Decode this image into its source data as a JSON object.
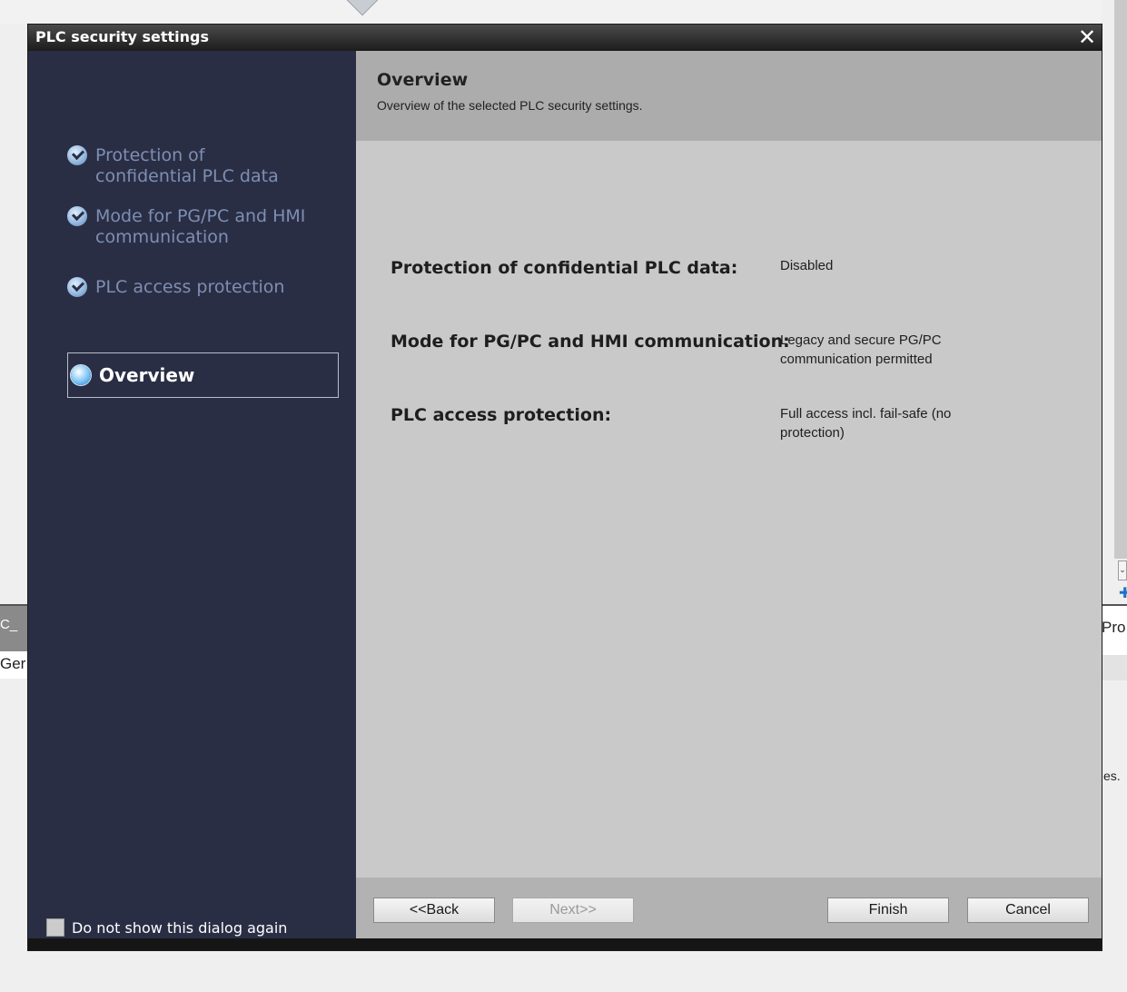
{
  "window": {
    "title": "PLC security settings",
    "close_glyph": "✕"
  },
  "background": {
    "left_tab_text": "C_",
    "left_tab2_text": "Ger",
    "right_tab_text": "Pro",
    "right_text": "es.",
    "scroll_glyph": "⌄",
    "plus_glyph": "✚"
  },
  "sidebar": {
    "steps": [
      {
        "label": "Protection of confidential PLC data",
        "icon": "check-circle-icon"
      },
      {
        "label": "Mode for PG/PC and HMI communication",
        "icon": "check-circle-icon"
      },
      {
        "label": "PLC access protection",
        "icon": "check-circle-icon"
      }
    ],
    "active_step": {
      "label": "Overview",
      "icon": "current-step-icon"
    },
    "dont_show_label": "Do not show this dialog again",
    "dont_show_checked": false
  },
  "content": {
    "header_title": "Overview",
    "header_subtitle": "Overview of the selected PLC security settings.",
    "rows": [
      {
        "label": "Protection of confidential PLC data:",
        "value": "Disabled"
      },
      {
        "label": "Mode for PG/PC and HMI communication:",
        "value": "Legacy and secure PG/PC communication permitted"
      },
      {
        "label": "PLC access protection:",
        "value": "Full access incl. fail-safe (no protection)"
      }
    ]
  },
  "footer": {
    "back_label": "<<Back",
    "next_label": "Next>>",
    "finish_label": "Finish",
    "cancel_label": "Cancel"
  }
}
